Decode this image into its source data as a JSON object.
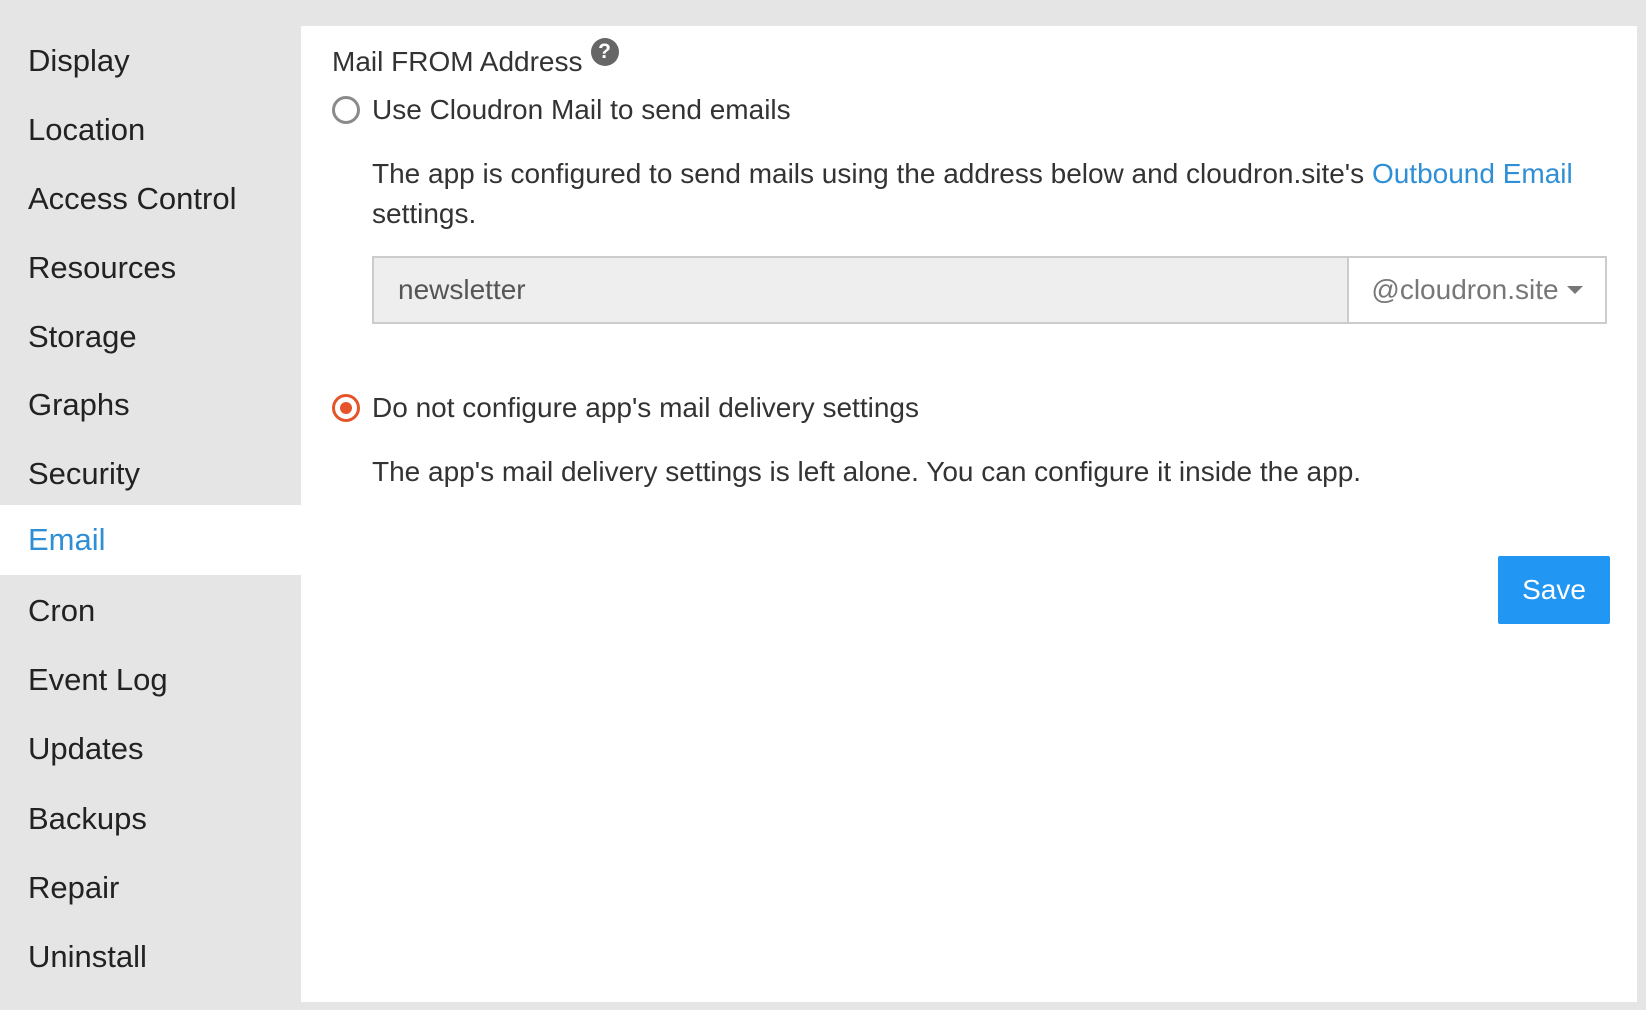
{
  "sidebar": {
    "items": [
      {
        "label": "Display"
      },
      {
        "label": "Location"
      },
      {
        "label": "Access Control"
      },
      {
        "label": "Resources"
      },
      {
        "label": "Storage"
      },
      {
        "label": "Graphs"
      },
      {
        "label": "Security"
      },
      {
        "label": "Email",
        "active": true
      },
      {
        "label": "Cron"
      },
      {
        "label": "Event Log"
      },
      {
        "label": "Updates"
      },
      {
        "label": "Backups"
      },
      {
        "label": "Repair"
      },
      {
        "label": "Uninstall"
      }
    ]
  },
  "main": {
    "heading": "Mail FROM Address",
    "help_icon": "?",
    "option_cloudron": {
      "label": "Use Cloudron Mail to send emails",
      "selected": false,
      "desc_before": "The app is configured to send mails using the address below and cloudron.site's ",
      "desc_link": "Outbound Email",
      "desc_after": "settings."
    },
    "mail_input": {
      "value": "newsletter"
    },
    "domain_select": {
      "value": "@cloudron.site"
    },
    "option_none": {
      "label": "Do not configure app's mail delivery settings",
      "selected": true,
      "desc": "The app's mail delivery settings is left alone. You can configure it inside the app."
    },
    "save_label": "Save"
  },
  "colors": {
    "accent": "#2e8fd6",
    "button": "#2196f3",
    "radio_checked": "#e5542a",
    "background": "#e5e5e5"
  }
}
